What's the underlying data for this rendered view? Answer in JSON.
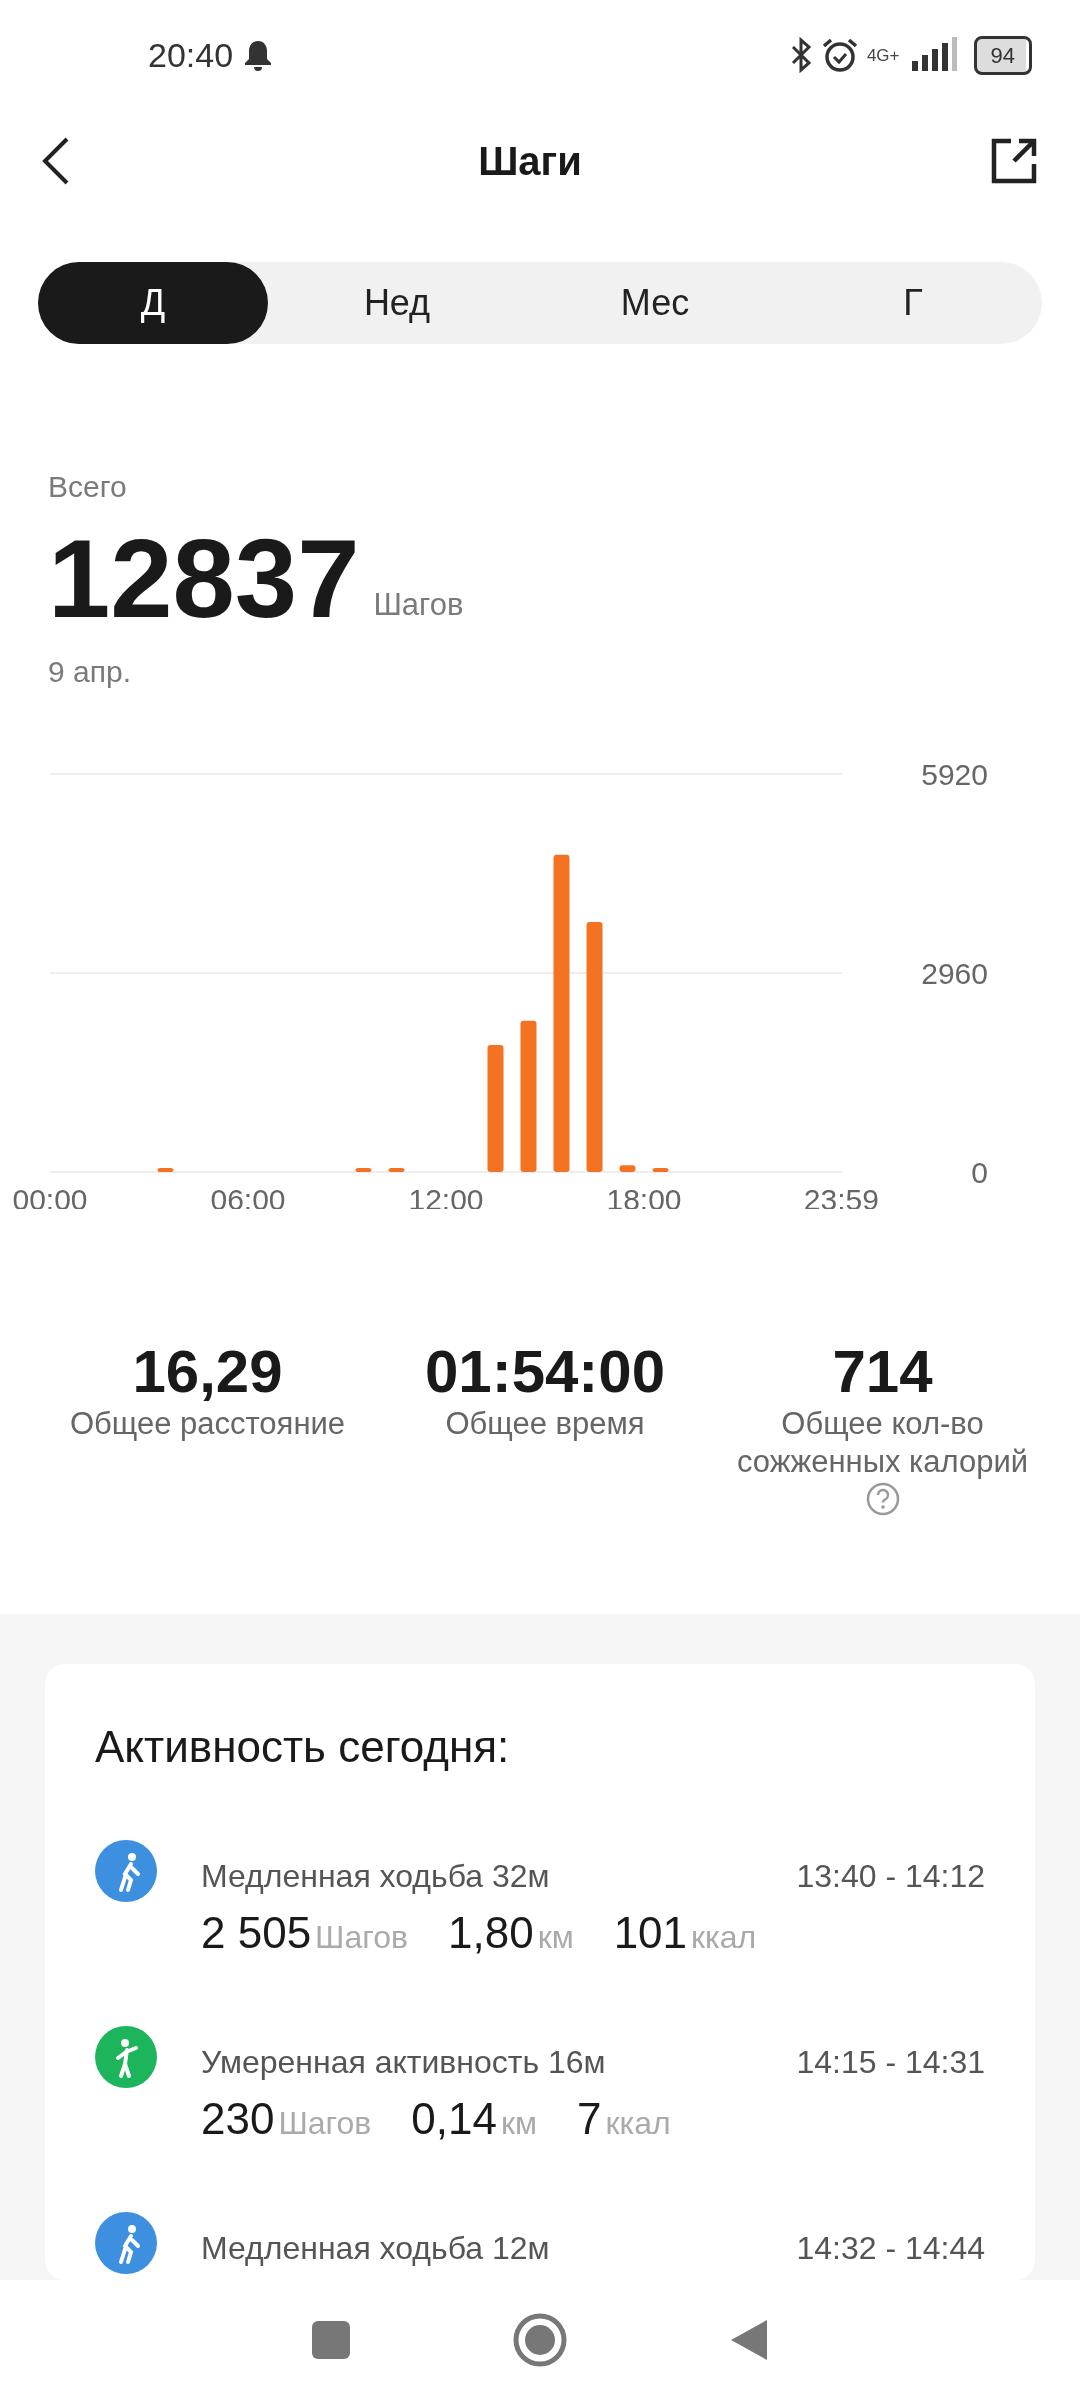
{
  "status_bar": {
    "time": "20:40",
    "network": "4G+",
    "battery": "94"
  },
  "header": {
    "title": "Шаги"
  },
  "tabs": [
    {
      "label": "Д",
      "selected": true
    },
    {
      "label": "Нед",
      "selected": false
    },
    {
      "label": "Мес",
      "selected": false
    },
    {
      "label": "Г",
      "selected": false
    }
  ],
  "summary": {
    "label": "Всего",
    "value": "12837",
    "unit": "Шагов",
    "date": "9 апр."
  },
  "chart_data": {
    "type": "bar",
    "x": [
      0.5,
      1.5,
      2.5,
      3.5,
      4.5,
      5.5,
      6.5,
      7.5,
      8.5,
      9.5,
      10.5,
      11.5,
      12.5,
      13.5,
      14.5,
      15.5,
      16.5,
      17.5,
      18.5,
      19.5,
      20.5,
      21.5,
      22.5,
      23.5
    ],
    "xlim": [
      0,
      24
    ],
    "values": [
      0,
      0,
      0,
      60,
      0,
      0,
      0,
      0,
      0,
      60,
      60,
      0,
      0,
      1890,
      2250,
      4720,
      3720,
      100,
      60,
      0,
      0,
      0,
      0,
      0
    ],
    "ylim": [
      0,
      5920
    ],
    "yticks": [
      0,
      2960,
      5920
    ],
    "xticks": [
      {
        "value": 0,
        "label": "00:00"
      },
      {
        "value": 6,
        "label": "06:00"
      },
      {
        "value": 12,
        "label": "12:00"
      },
      {
        "value": 18,
        "label": "18:00"
      },
      {
        "value": 23.98,
        "label": "23:59"
      }
    ]
  },
  "stats": [
    {
      "value": "16,29",
      "label": "Общее расстояние",
      "help": false
    },
    {
      "value": "01:54:00",
      "label": "Общее время",
      "help": false
    },
    {
      "value": "714",
      "label": "Общее кол-во сожженных калорий",
      "help": true
    }
  ],
  "activity": {
    "title": "Активность сегодня:",
    "items": [
      {
        "kind": "walk",
        "color": "#3d8fe0",
        "name": "Медленная ходьба 32м",
        "time": "13:40 - 14:12",
        "metrics": [
          {
            "value": "2 505",
            "unit": "Шагов"
          },
          {
            "value": "1,80",
            "unit": "км"
          },
          {
            "value": "101",
            "unit": "ккал"
          }
        ]
      },
      {
        "kind": "moderate",
        "color": "#1db55c",
        "name": "Умеренная активность 16м",
        "time": "14:15 - 14:31",
        "metrics": [
          {
            "value": "230",
            "unit": "Шагов"
          },
          {
            "value": "0,14",
            "unit": "км"
          },
          {
            "value": "7",
            "unit": "ккал"
          }
        ]
      },
      {
        "kind": "walk",
        "color": "#3d8fe0",
        "name": "Медленная ходьба 12м",
        "time": "14:32 - 14:44"
      }
    ]
  }
}
